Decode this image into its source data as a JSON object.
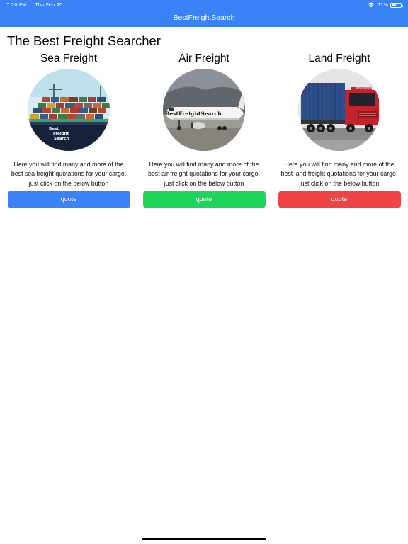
{
  "status_bar": {
    "time": "7:20 PM",
    "date": "Thu Feb 20",
    "battery": "51%",
    "battery_level": 0.51
  },
  "app": {
    "title": "BestFreightSearch",
    "header_color": "#3b82f6"
  },
  "main": {
    "title": "The Best Freight Searcher",
    "cards": [
      {
        "title": "Sea Freight",
        "image_text": [
          "Best",
          "Freight",
          "Search"
        ],
        "description": "Here you will find many and more of the best sea freight quotations for your cargo, just click on the below button",
        "button_label": "quote",
        "button_color": "#3b82f6"
      },
      {
        "title": "Air Freight",
        "image_text": "BestFreightSearch",
        "description": "Here you will find many and more of the best air freight quotations for your cargo, just click on the below button",
        "button_label": "quote",
        "button_color": "#1ed45a"
      },
      {
        "title": "Land Freight",
        "image_text": "BestFreightSearch",
        "description": "Here you will find many and more of the best land freight quotations for your cargo, just click on the below button",
        "button_label": "quote",
        "button_color": "#f04444"
      }
    ]
  }
}
